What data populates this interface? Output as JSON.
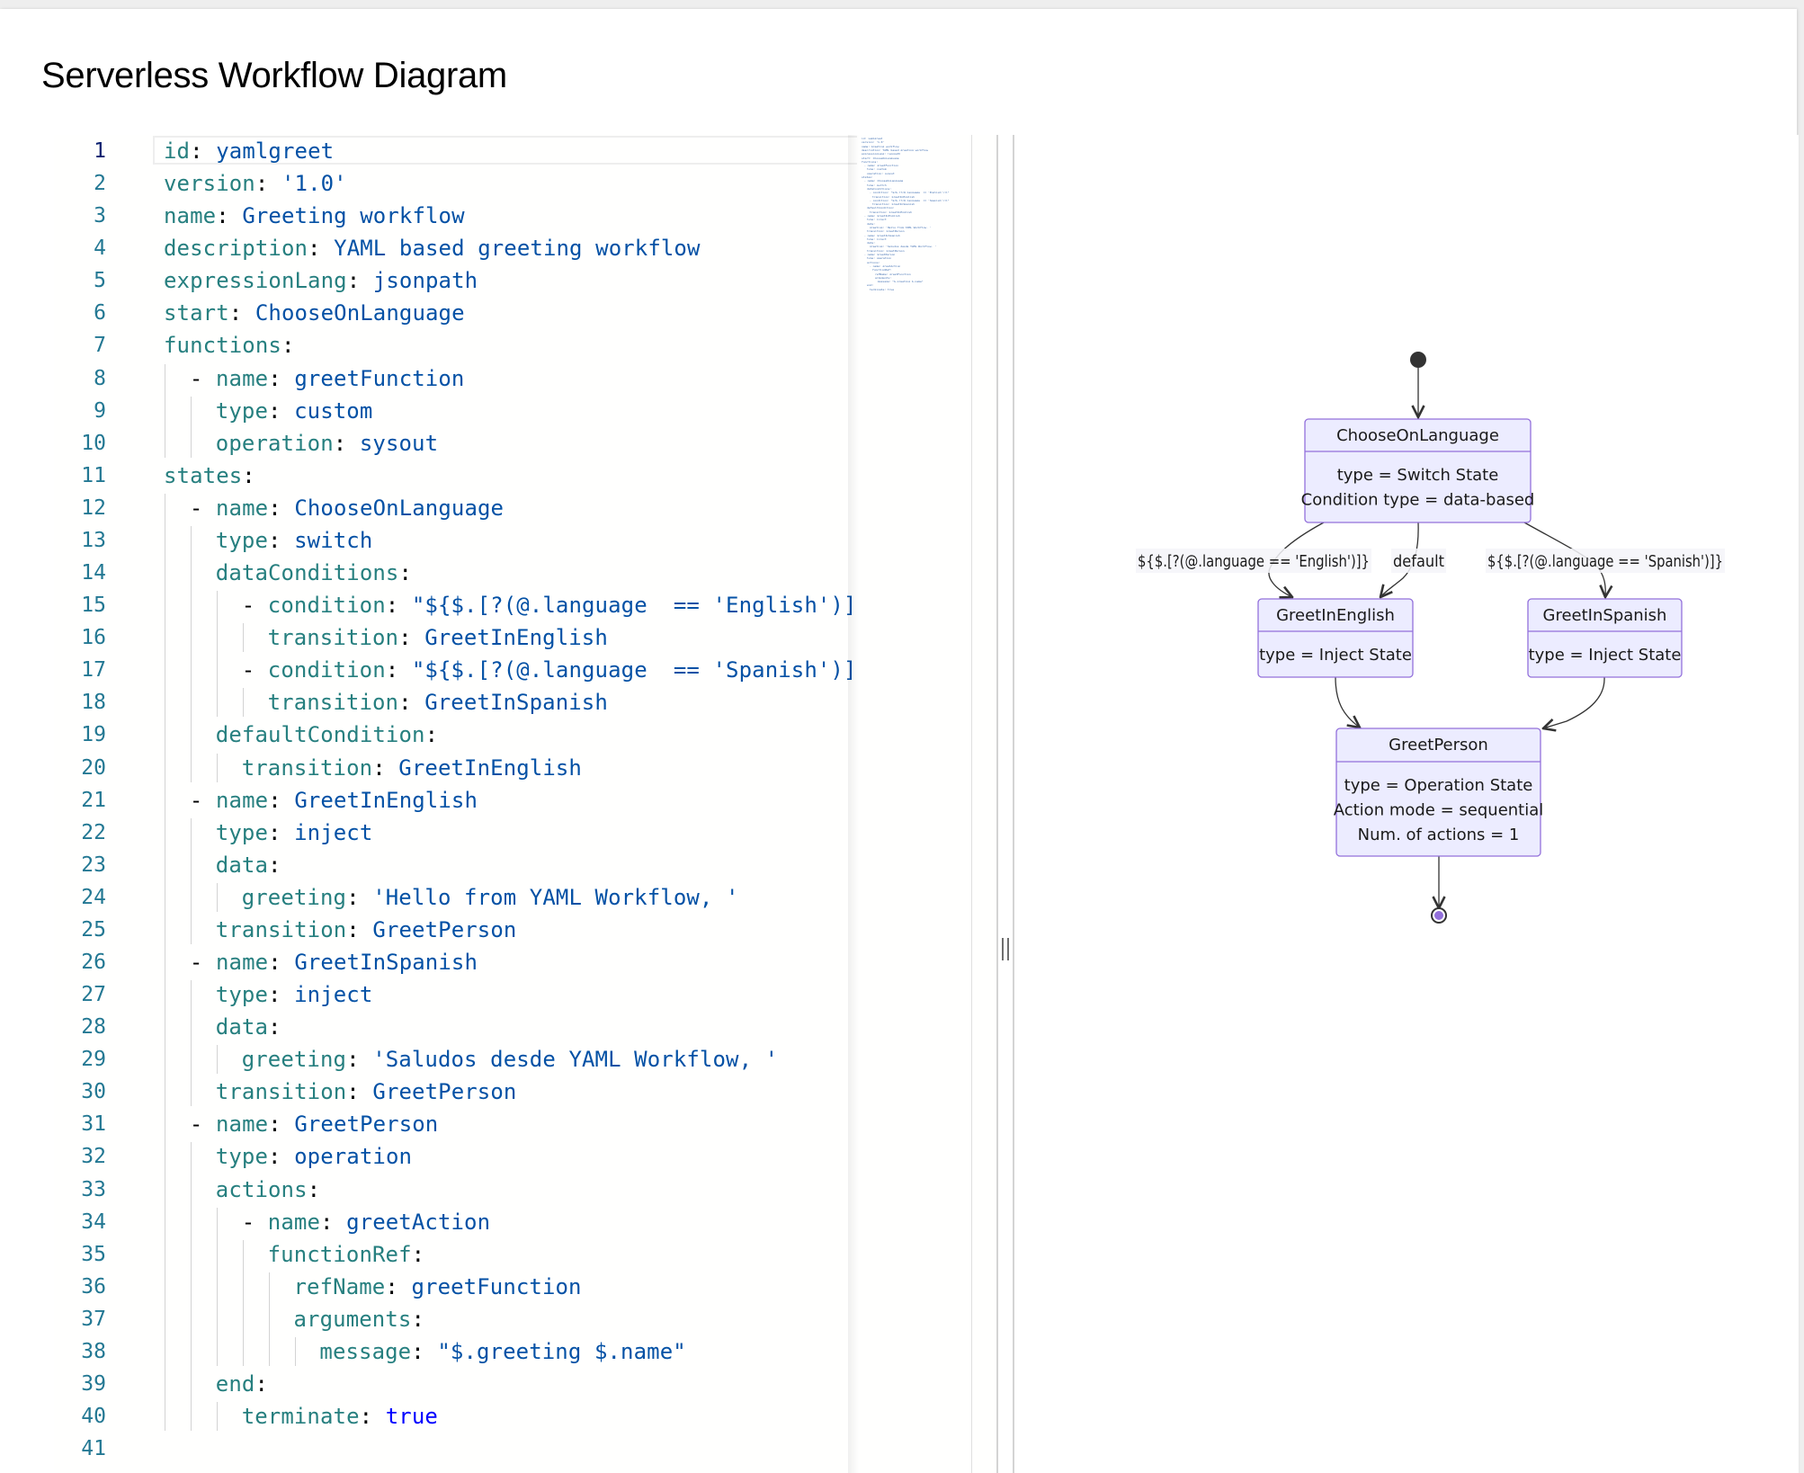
{
  "page": {
    "title": "Serverless Workflow Diagram"
  },
  "editor": {
    "language": "yaml",
    "active_line": 1,
    "lines": [
      {
        "n": "1",
        "indent": 0,
        "tokens": [
          [
            "key",
            "id"
          ],
          [
            "punct",
            ": "
          ],
          [
            "val",
            "yamlgreet"
          ]
        ]
      },
      {
        "n": "2",
        "indent": 0,
        "tokens": [
          [
            "key",
            "version"
          ],
          [
            "punct",
            ": "
          ],
          [
            "val",
            "'1.0'"
          ]
        ]
      },
      {
        "n": "3",
        "indent": 0,
        "tokens": [
          [
            "key",
            "name"
          ],
          [
            "punct",
            ": "
          ],
          [
            "val",
            "Greeting workflow"
          ]
        ]
      },
      {
        "n": "4",
        "indent": 0,
        "tokens": [
          [
            "key",
            "description"
          ],
          [
            "punct",
            ": "
          ],
          [
            "val",
            "YAML based greeting workflow"
          ]
        ]
      },
      {
        "n": "5",
        "indent": 0,
        "tokens": [
          [
            "key",
            "expressionLang"
          ],
          [
            "punct",
            ": "
          ],
          [
            "val",
            "jsonpath"
          ]
        ]
      },
      {
        "n": "6",
        "indent": 0,
        "tokens": [
          [
            "key",
            "start"
          ],
          [
            "punct",
            ": "
          ],
          [
            "val",
            "ChooseOnLanguage"
          ]
        ]
      },
      {
        "n": "7",
        "indent": 0,
        "tokens": [
          [
            "key",
            "functions"
          ],
          [
            "punct",
            ":"
          ]
        ]
      },
      {
        "n": "8",
        "indent": 1,
        "tokens": [
          [
            "dash",
            "- "
          ],
          [
            "key",
            "name"
          ],
          [
            "punct",
            ": "
          ],
          [
            "val",
            "greetFunction"
          ]
        ]
      },
      {
        "n": "9",
        "indent": 2,
        "tokens": [
          [
            "key",
            "type"
          ],
          [
            "punct",
            ": "
          ],
          [
            "val",
            "custom"
          ]
        ]
      },
      {
        "n": "10",
        "indent": 2,
        "tokens": [
          [
            "key",
            "operation"
          ],
          [
            "punct",
            ": "
          ],
          [
            "val",
            "sysout"
          ]
        ]
      },
      {
        "n": "11",
        "indent": 0,
        "tokens": [
          [
            "key",
            "states"
          ],
          [
            "punct",
            ":"
          ]
        ]
      },
      {
        "n": "12",
        "indent": 1,
        "tokens": [
          [
            "dash",
            "- "
          ],
          [
            "key",
            "name"
          ],
          [
            "punct",
            ": "
          ],
          [
            "val",
            "ChooseOnLanguage"
          ]
        ]
      },
      {
        "n": "13",
        "indent": 2,
        "tokens": [
          [
            "key",
            "type"
          ],
          [
            "punct",
            ": "
          ],
          [
            "val",
            "switch"
          ]
        ]
      },
      {
        "n": "14",
        "indent": 2,
        "tokens": [
          [
            "key",
            "dataConditions"
          ],
          [
            "punct",
            ":"
          ]
        ]
      },
      {
        "n": "15",
        "indent": 3,
        "tokens": [
          [
            "dash",
            "- "
          ],
          [
            "key",
            "condition"
          ],
          [
            "punct",
            ": "
          ],
          [
            "val",
            "\"${$.[?(@.language  == 'English')]}\""
          ]
        ]
      },
      {
        "n": "16",
        "indent": 4,
        "tokens": [
          [
            "key",
            "transition"
          ],
          [
            "punct",
            ": "
          ],
          [
            "val",
            "GreetInEnglish"
          ]
        ]
      },
      {
        "n": "17",
        "indent": 3,
        "tokens": [
          [
            "dash",
            "- "
          ],
          [
            "key",
            "condition"
          ],
          [
            "punct",
            ": "
          ],
          [
            "val",
            "\"${$.[?(@.language  == 'Spanish')]}\""
          ]
        ]
      },
      {
        "n": "18",
        "indent": 4,
        "tokens": [
          [
            "key",
            "transition"
          ],
          [
            "punct",
            ": "
          ],
          [
            "val",
            "GreetInSpanish"
          ]
        ]
      },
      {
        "n": "19",
        "indent": 2,
        "tokens": [
          [
            "key",
            "defaultCondition"
          ],
          [
            "punct",
            ":"
          ]
        ]
      },
      {
        "n": "20",
        "indent": 3,
        "tokens": [
          [
            "key",
            "transition"
          ],
          [
            "punct",
            ": "
          ],
          [
            "val",
            "GreetInEnglish"
          ]
        ]
      },
      {
        "n": "21",
        "indent": 1,
        "tokens": [
          [
            "dash",
            "- "
          ],
          [
            "key",
            "name"
          ],
          [
            "punct",
            ": "
          ],
          [
            "val",
            "GreetInEnglish"
          ]
        ]
      },
      {
        "n": "22",
        "indent": 2,
        "tokens": [
          [
            "key",
            "type"
          ],
          [
            "punct",
            ": "
          ],
          [
            "val",
            "inject"
          ]
        ]
      },
      {
        "n": "23",
        "indent": 2,
        "tokens": [
          [
            "key",
            "data"
          ],
          [
            "punct",
            ":"
          ]
        ]
      },
      {
        "n": "24",
        "indent": 3,
        "tokens": [
          [
            "key",
            "greeting"
          ],
          [
            "punct",
            ": "
          ],
          [
            "val",
            "'Hello from YAML Workflow, '"
          ]
        ]
      },
      {
        "n": "25",
        "indent": 2,
        "tokens": [
          [
            "key",
            "transition"
          ],
          [
            "punct",
            ": "
          ],
          [
            "val",
            "GreetPerson"
          ]
        ]
      },
      {
        "n": "26",
        "indent": 1,
        "tokens": [
          [
            "dash",
            "- "
          ],
          [
            "key",
            "name"
          ],
          [
            "punct",
            ": "
          ],
          [
            "val",
            "GreetInSpanish"
          ]
        ]
      },
      {
        "n": "27",
        "indent": 2,
        "tokens": [
          [
            "key",
            "type"
          ],
          [
            "punct",
            ": "
          ],
          [
            "val",
            "inject"
          ]
        ]
      },
      {
        "n": "28",
        "indent": 2,
        "tokens": [
          [
            "key",
            "data"
          ],
          [
            "punct",
            ":"
          ]
        ]
      },
      {
        "n": "29",
        "indent": 3,
        "tokens": [
          [
            "key",
            "greeting"
          ],
          [
            "punct",
            ": "
          ],
          [
            "val",
            "'Saludos desde YAML Workflow, '"
          ]
        ]
      },
      {
        "n": "30",
        "indent": 2,
        "tokens": [
          [
            "key",
            "transition"
          ],
          [
            "punct",
            ": "
          ],
          [
            "val",
            "GreetPerson"
          ]
        ]
      },
      {
        "n": "31",
        "indent": 1,
        "tokens": [
          [
            "dash",
            "- "
          ],
          [
            "key",
            "name"
          ],
          [
            "punct",
            ": "
          ],
          [
            "val",
            "GreetPerson"
          ]
        ]
      },
      {
        "n": "32",
        "indent": 2,
        "tokens": [
          [
            "key",
            "type"
          ],
          [
            "punct",
            ": "
          ],
          [
            "val",
            "operation"
          ]
        ]
      },
      {
        "n": "33",
        "indent": 2,
        "tokens": [
          [
            "key",
            "actions"
          ],
          [
            "punct",
            ":"
          ]
        ]
      },
      {
        "n": "34",
        "indent": 3,
        "tokens": [
          [
            "dash",
            "- "
          ],
          [
            "key",
            "name"
          ],
          [
            "punct",
            ": "
          ],
          [
            "val",
            "greetAction"
          ]
        ]
      },
      {
        "n": "35",
        "indent": 4,
        "tokens": [
          [
            "key",
            "functionRef"
          ],
          [
            "punct",
            ":"
          ]
        ]
      },
      {
        "n": "36",
        "indent": 5,
        "tokens": [
          [
            "key",
            "refName"
          ],
          [
            "punct",
            ": "
          ],
          [
            "val",
            "greetFunction"
          ]
        ]
      },
      {
        "n": "37",
        "indent": 5,
        "tokens": [
          [
            "key",
            "arguments"
          ],
          [
            "punct",
            ":"
          ]
        ]
      },
      {
        "n": "38",
        "indent": 6,
        "tokens": [
          [
            "key",
            "message"
          ],
          [
            "punct",
            ": "
          ],
          [
            "val",
            "\"$.greeting $.name\""
          ]
        ]
      },
      {
        "n": "39",
        "indent": 2,
        "tokens": [
          [
            "key",
            "end"
          ],
          [
            "punct",
            ":"
          ]
        ]
      },
      {
        "n": "40",
        "indent": 3,
        "tokens": [
          [
            "key",
            "terminate"
          ],
          [
            "punct",
            ": "
          ],
          [
            "bool",
            "true"
          ]
        ]
      },
      {
        "n": "41",
        "indent": 0,
        "tokens": []
      }
    ]
  },
  "diagram": {
    "colors": {
      "node_fill": "#ECECFF",
      "node_stroke": "#9370DB",
      "edge": "#333333",
      "label_bg": "#F4F4F9",
      "start": "#333333",
      "end_fill": "#9370DB"
    },
    "nodes": [
      {
        "id": "ChooseOnLanguage",
        "title": "ChooseOnLanguage",
        "lines": [
          "type = Switch State",
          "Condition type = data-based"
        ]
      },
      {
        "id": "GreetInEnglish",
        "title": "GreetInEnglish",
        "lines": [
          "type = Inject State"
        ]
      },
      {
        "id": "GreetInSpanish",
        "title": "GreetInSpanish",
        "lines": [
          "type = Inject State"
        ]
      },
      {
        "id": "GreetPerson",
        "title": "GreetPerson",
        "lines": [
          "type = Operation State",
          "Action mode = sequential",
          "Num. of actions = 1"
        ]
      }
    ],
    "edges": [
      {
        "from": "start",
        "to": "ChooseOnLanguage",
        "label": ""
      },
      {
        "from": "ChooseOnLanguage",
        "to": "GreetInEnglish",
        "label": "${$.[?(@.language == 'English')]}"
      },
      {
        "from": "ChooseOnLanguage",
        "to": "GreetInEnglish",
        "label": "default"
      },
      {
        "from": "ChooseOnLanguage",
        "to": "GreetInSpanish",
        "label": "${$.[?(@.language == 'Spanish')]}"
      },
      {
        "from": "GreetInEnglish",
        "to": "GreetPerson",
        "label": ""
      },
      {
        "from": "GreetInSpanish",
        "to": "GreetPerson",
        "label": ""
      },
      {
        "from": "GreetPerson",
        "to": "end",
        "label": ""
      }
    ]
  }
}
